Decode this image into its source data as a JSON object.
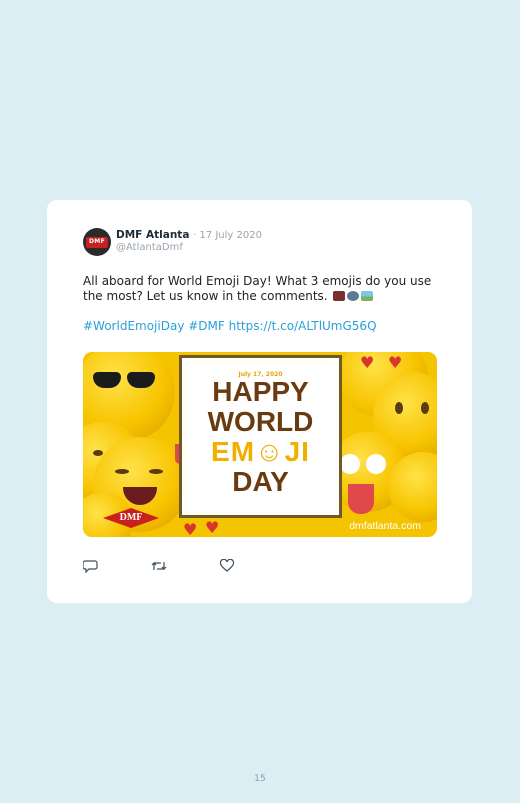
{
  "tweet": {
    "author_name": "DMF Atlanta",
    "date": "· 17 July 2020",
    "handle": "@AtlantaDmf",
    "avatar_text": "DMF",
    "text": "All aboard for World Emoji Day! What 3 emojis do you use the most? Let us know in the comments.",
    "emojis": [
      "train-emoji",
      "gear-emoji",
      "landscape-emoji"
    ],
    "hashtags_line": "#WorldEmojiDay #DMF https://t.co/ALTlUmG56Q"
  },
  "media": {
    "date_label": "July 17, 2020",
    "headline_lines": [
      "HAPPY",
      "WORLD",
      "EM☺JI",
      "DAY"
    ],
    "logo_text": "DMF",
    "site": "dmfatlanta.com"
  },
  "actions": [
    "reply-icon",
    "retweet-icon",
    "like-icon"
  ],
  "page_number": "15",
  "colors": {
    "background": "#daeef4",
    "link": "#2aa0d8",
    "brand_red": "#c8201f",
    "emoji_yellow": "#f7c400"
  }
}
